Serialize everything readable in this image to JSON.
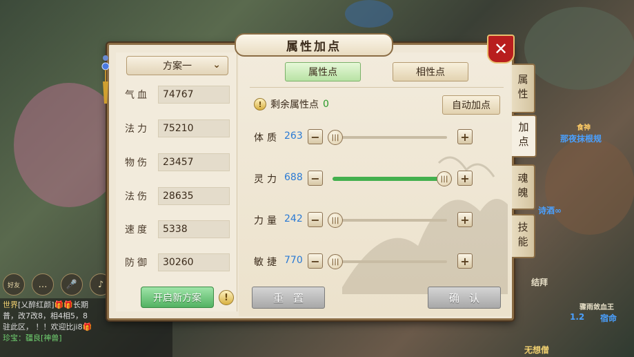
{
  "dialog": {
    "title": "属性加点",
    "close_icon": "close-icon"
  },
  "left": {
    "scheme_select": "方案一",
    "stats": [
      {
        "label": "气血",
        "value": "74767"
      },
      {
        "label": "法力",
        "value": "75210"
      },
      {
        "label": "物伤",
        "value": "23457"
      },
      {
        "label": "法伤",
        "value": "28635"
      },
      {
        "label": "速度",
        "value": "5338"
      },
      {
        "label": "防御",
        "value": "30260"
      }
    ],
    "new_scheme_label": "开启新方案",
    "warn_glyph": "!"
  },
  "right": {
    "tab_attr": "属性点",
    "tab_affinity": "相性点",
    "remaining_label": "剩余属性点",
    "remaining_value": "0",
    "auto_label": "自动加点",
    "attributes": [
      {
        "label": "体质",
        "value": "263",
        "level": 0.0
      },
      {
        "label": "灵力",
        "value": "688",
        "level": 1.0
      },
      {
        "label": "力量",
        "value": "242",
        "level": 0.0
      },
      {
        "label": "敏捷",
        "value": "770",
        "level": 0.0
      }
    ],
    "minus": "−",
    "plus": "+",
    "reset_label": "重置",
    "confirm_label": "确认"
  },
  "side_tabs": [
    {
      "label": "属性",
      "active": false
    },
    {
      "label": "加点",
      "active": true
    },
    {
      "label": "魂魄",
      "active": false
    },
    {
      "label": "技能",
      "active": false
    }
  ],
  "background": {
    "bottom_icons": [
      "好友",
      "",
      "",
      ""
    ],
    "chat": [
      {
        "tag": "世界",
        "text": "[乂醉红颜]🎁🎁长期"
      },
      {
        "tag": "",
        "text": "普，改7改8，相4相5，8"
      },
      {
        "tag": "",
        "text": "驻此区，          ！！欢迎比ji8🎁"
      },
      {
        "tag": "",
        "text": "珍宝：疆良[神兽]"
      }
    ],
    "scene_labels": [
      "那夜抹根规",
      "结拜",
      "诗酒∞",
      "无想僧",
      "食神",
      "宿命",
      "骤雨敛血王",
      "1.2"
    ]
  },
  "colors": {
    "accent_green": "#52b262",
    "value_blue": "#2a7ad4",
    "close_red": "#b81e1e",
    "frame_brown": "#8a6c44"
  }
}
